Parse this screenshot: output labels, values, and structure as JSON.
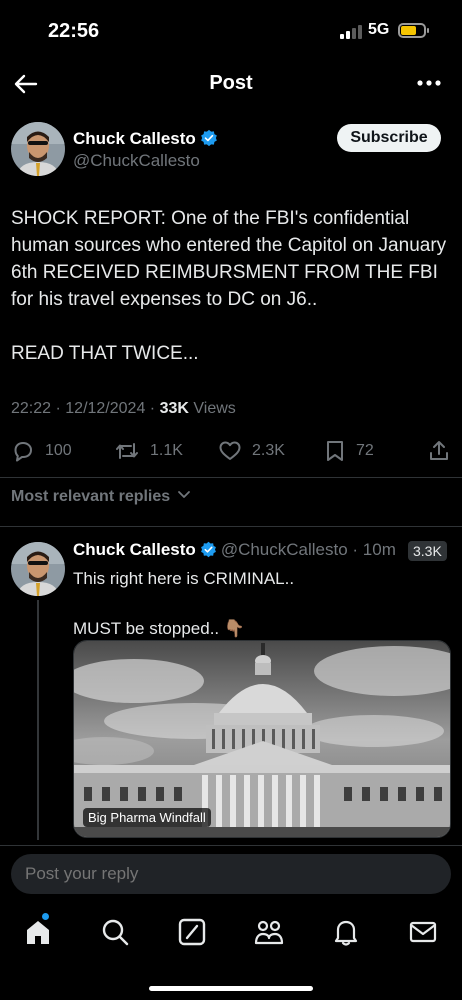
{
  "status": {
    "time": "22:56",
    "network": "5G"
  },
  "header": {
    "title": "Post"
  },
  "post": {
    "author_name": "Chuck Callesto",
    "author_handle": "@ChuckCallesto",
    "subscribe_label": "Subscribe",
    "text": "SHOCK REPORT: One of the FBI's confidential human sources who entered the Capitol on January 6th RECEIVED REIMBURSMENT FROM THE FBI for his travel expenses to DC on J6..\n\nREAD THAT TWICE...",
    "time": "22:22",
    "date": "12/12/2024",
    "views_count": "33K",
    "views_label": "Views",
    "replies": "100",
    "reposts": "1.1K",
    "likes": "2.3K",
    "bookmarks": "72"
  },
  "replies_sort": {
    "label": "Most relevant replies"
  },
  "reply": {
    "author_name": "Chuck Callesto",
    "author_handle": "@ChuckCallesto",
    "time": "10m",
    "views": "3.3K",
    "text": "This right here is CRIMINAL..\n\nMUST be stopped.. 👇🏽",
    "media_caption": "Big Pharma Windfall"
  },
  "composer": {
    "placeholder": "Post your reply"
  },
  "tabs": [
    "home-icon",
    "search-icon",
    "grok-icon",
    "communities-icon",
    "notifications-icon",
    "messages-icon"
  ],
  "colors": {
    "accent": "#1d9bf0",
    "background": "#000000",
    "muted": "#71767b",
    "battery": "#f5c400"
  }
}
